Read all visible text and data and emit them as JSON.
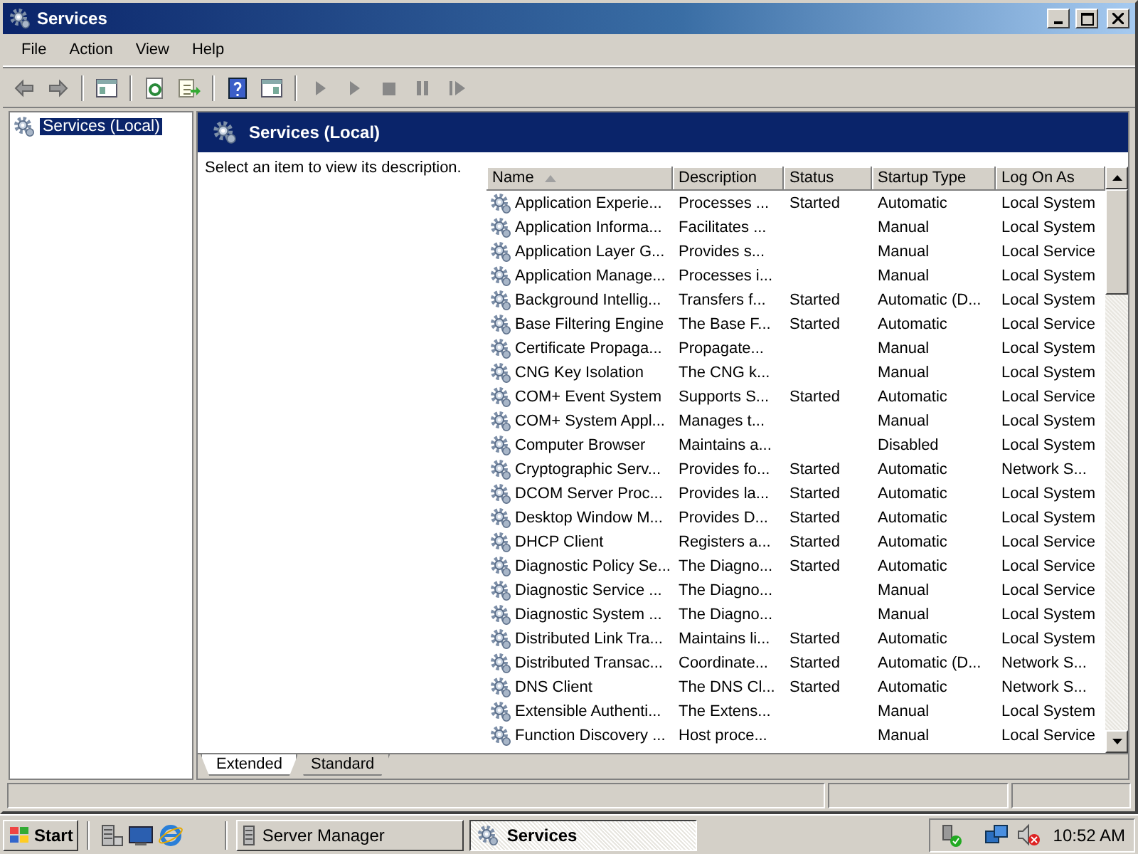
{
  "window": {
    "title": "Services"
  },
  "menu": [
    "File",
    "Action",
    "View",
    "Help"
  ],
  "tree": [
    {
      "label": "Services (Local)",
      "selected": true
    }
  ],
  "pane": {
    "title": "Services (Local)",
    "hint": "Select an item to view its description."
  },
  "table": {
    "columns": [
      {
        "label": "Name",
        "sorted": true
      },
      {
        "label": "Description",
        "sorted": false
      },
      {
        "label": "Status",
        "sorted": false
      },
      {
        "label": "Startup Type",
        "sorted": false
      },
      {
        "label": "Log On As",
        "sorted": false
      }
    ],
    "rows": [
      [
        "Application Experie...",
        "Processes ...",
        "Started",
        "Automatic",
        "Local System"
      ],
      [
        "Application Informa...",
        "Facilitates ...",
        "",
        "Manual",
        "Local System"
      ],
      [
        "Application Layer G...",
        "Provides s...",
        "",
        "Manual",
        "Local Service"
      ],
      [
        "Application Manage...",
        "Processes i...",
        "",
        "Manual",
        "Local System"
      ],
      [
        "Background Intellig...",
        "Transfers f...",
        "Started",
        "Automatic (D...",
        "Local System"
      ],
      [
        "Base Filtering Engine",
        "The Base F...",
        "Started",
        "Automatic",
        "Local Service"
      ],
      [
        "Certificate Propaga...",
        "Propagate...",
        "",
        "Manual",
        "Local System"
      ],
      [
        "CNG Key Isolation",
        "The CNG k...",
        "",
        "Manual",
        "Local System"
      ],
      [
        "COM+ Event System",
        "Supports S...",
        "Started",
        "Automatic",
        "Local Service"
      ],
      [
        "COM+ System Appl...",
        "Manages t...",
        "",
        "Manual",
        "Local System"
      ],
      [
        "Computer Browser",
        "Maintains a...",
        "",
        "Disabled",
        "Local System"
      ],
      [
        "Cryptographic Serv...",
        "Provides fo...",
        "Started",
        "Automatic",
        "Network S..."
      ],
      [
        "DCOM Server Proc...",
        "Provides la...",
        "Started",
        "Automatic",
        "Local System"
      ],
      [
        "Desktop Window M...",
        "Provides D...",
        "Started",
        "Automatic",
        "Local System"
      ],
      [
        "DHCP Client",
        "Registers a...",
        "Started",
        "Automatic",
        "Local Service"
      ],
      [
        "Diagnostic Policy Se...",
        "The Diagno...",
        "Started",
        "Automatic",
        "Local Service"
      ],
      [
        "Diagnostic Service ...",
        "The Diagno...",
        "",
        "Manual",
        "Local Service"
      ],
      [
        "Diagnostic System ...",
        "The Diagno...",
        "",
        "Manual",
        "Local System"
      ],
      [
        "Distributed Link Tra...",
        "Maintains li...",
        "Started",
        "Automatic",
        "Local System"
      ],
      [
        "Distributed Transac...",
        "Coordinate...",
        "Started",
        "Automatic (D...",
        "Network S..."
      ],
      [
        "DNS Client",
        "The DNS Cl...",
        "Started",
        "Automatic",
        "Network S..."
      ],
      [
        "Extensible Authenti...",
        "The Extens...",
        "",
        "Manual",
        "Local System"
      ],
      [
        "Function Discovery ...",
        "Host proce...",
        "",
        "Manual",
        "Local Service"
      ]
    ]
  },
  "tabs": [
    {
      "label": "Extended",
      "selected": true
    },
    {
      "label": "Standard",
      "selected": false
    }
  ],
  "taskbar": {
    "start": "Start",
    "buttons": [
      {
        "label": "Server Manager",
        "selected": false
      },
      {
        "label": "Services",
        "selected": true
      }
    ],
    "clock": "10:52 AM"
  }
}
